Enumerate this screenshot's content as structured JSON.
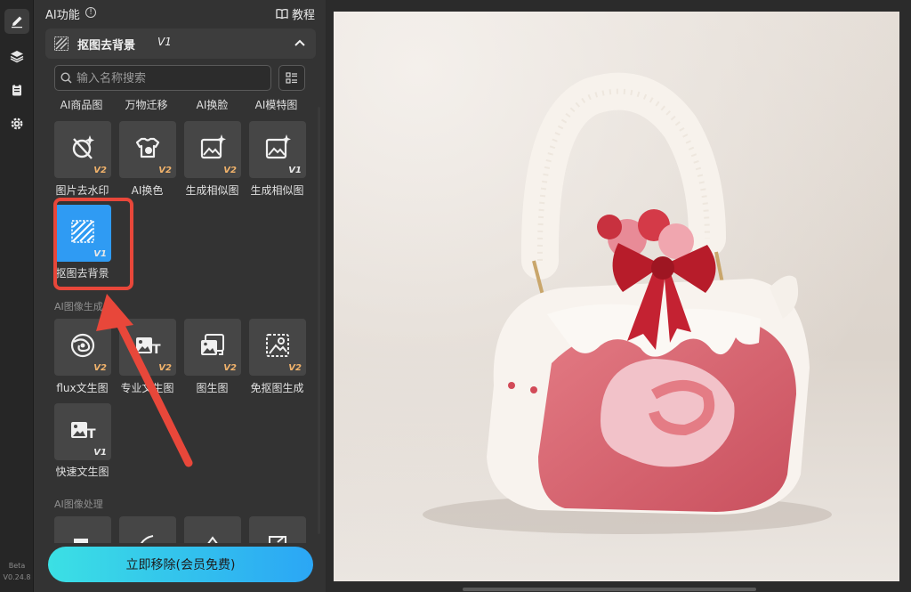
{
  "rail": {
    "version_label": "Beta",
    "version": "V0.24.8"
  },
  "panel": {
    "title": "AI功能",
    "tutorial_label": "教程",
    "section": {
      "title": "抠图去背景",
      "version": "V1"
    },
    "search": {
      "placeholder": "输入名称搜索"
    },
    "top_labels": [
      "AI商品图",
      "万物迁移",
      "AI换脸",
      "AI模特图"
    ],
    "row1": [
      {
        "label": "图片去水印",
        "badge": "V2"
      },
      {
        "label": "AI换色",
        "badge": "V2"
      },
      {
        "label": "生成相似图",
        "badge": "V2"
      },
      {
        "label": "生成相似图",
        "badge": "V1"
      }
    ],
    "row2": [
      {
        "label": "抠图去背景",
        "badge": "V1"
      }
    ],
    "category_generate": "AI图像生成",
    "row3": [
      {
        "label": "flux文生图",
        "badge": "V2"
      },
      {
        "label": "专业文生图",
        "badge": "V2"
      },
      {
        "label": "图生图",
        "badge": "V2"
      },
      {
        "label": "免抠图生成",
        "badge": "V2"
      }
    ],
    "row4": [
      {
        "label": "快速文生图",
        "badge": "V1"
      }
    ],
    "category_process": "AI图像处理"
  },
  "cta": {
    "label": "立即移除(会员免费)"
  },
  "colors": {
    "accent": "#2f9bf3",
    "highlight": "#e8473a",
    "badge": "#f2b36b",
    "cta_start": "#3be0e4",
    "cta_end": "#2ba6f5"
  }
}
